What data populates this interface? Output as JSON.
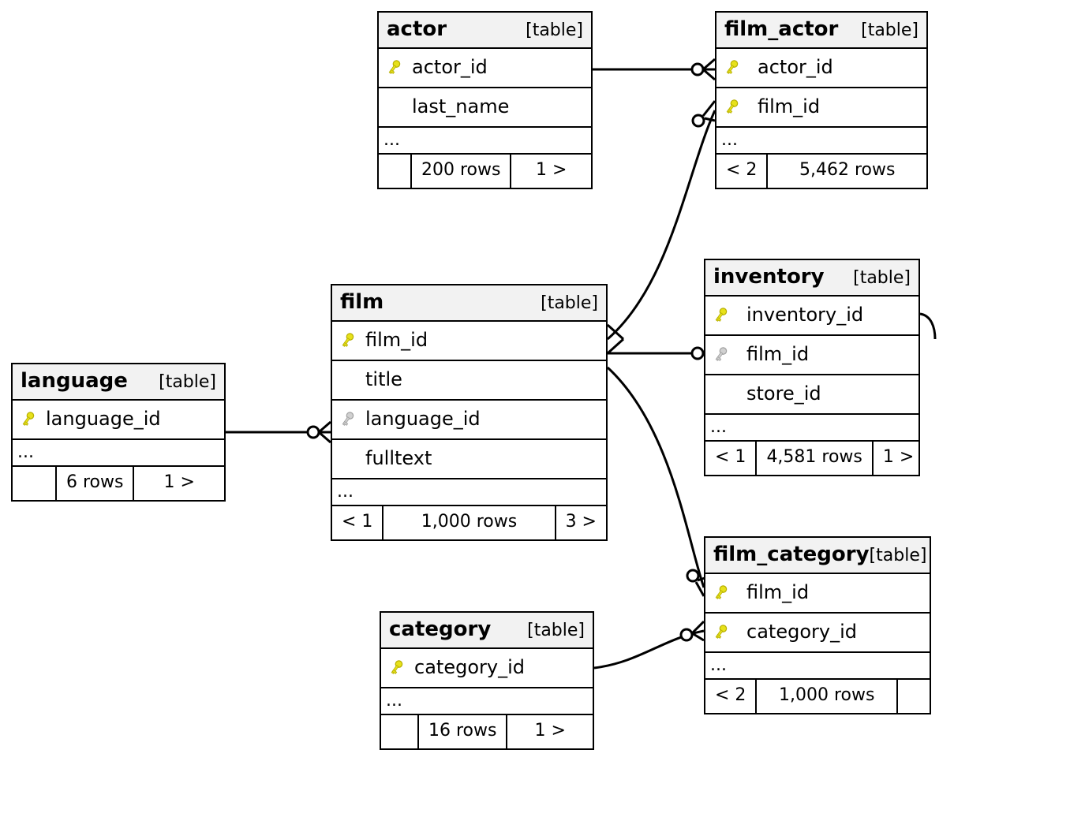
{
  "type_label": "[table]",
  "ellipsis": "...",
  "tables": {
    "actor": {
      "name": "actor",
      "cols": {
        "actor_id": "actor_id",
        "last_name": "last_name"
      },
      "footer": {
        "rows": "200 rows",
        "right": "1 >"
      }
    },
    "film_actor": {
      "name": "film_actor",
      "cols": {
        "actor_id": "actor_id",
        "film_id": "film_id"
      },
      "footer": {
        "left": "< 2",
        "rows": "5,462 rows"
      }
    },
    "film": {
      "name": "film",
      "cols": {
        "film_id": "film_id",
        "title": "title",
        "language_id": "language_id",
        "fulltext": "fulltext"
      },
      "footer": {
        "left": "< 1",
        "rows": "1,000 rows",
        "right": "3 >"
      }
    },
    "language": {
      "name": "language",
      "cols": {
        "language_id": "language_id"
      },
      "footer": {
        "rows": "6 rows",
        "right": "1 >"
      }
    },
    "inventory": {
      "name": "inventory",
      "cols": {
        "inventory_id": "inventory_id",
        "film_id": "film_id",
        "store_id": "store_id"
      },
      "footer": {
        "left": "< 1",
        "rows": "4,581 rows",
        "right": "1 >"
      }
    },
    "category": {
      "name": "category",
      "cols": {
        "category_id": "category_id"
      },
      "footer": {
        "rows": "16 rows",
        "right": "1 >"
      }
    },
    "film_category": {
      "name": "film_category",
      "cols": {
        "film_id": "film_id",
        "category_id": "category_id"
      },
      "footer": {
        "left": "< 2",
        "rows": "1,000 rows"
      }
    }
  },
  "relations": [
    {
      "from": "language.language_id",
      "to": "film.language_id"
    },
    {
      "from": "actor.actor_id",
      "to": "film_actor.actor_id"
    },
    {
      "from": "film.film_id",
      "to": "film_actor.film_id"
    },
    {
      "from": "film.film_id",
      "to": "inventory.film_id"
    },
    {
      "from": "film.film_id",
      "to": "film_category.film_id"
    },
    {
      "from": "category.category_id",
      "to": "film_category.category_id"
    }
  ]
}
